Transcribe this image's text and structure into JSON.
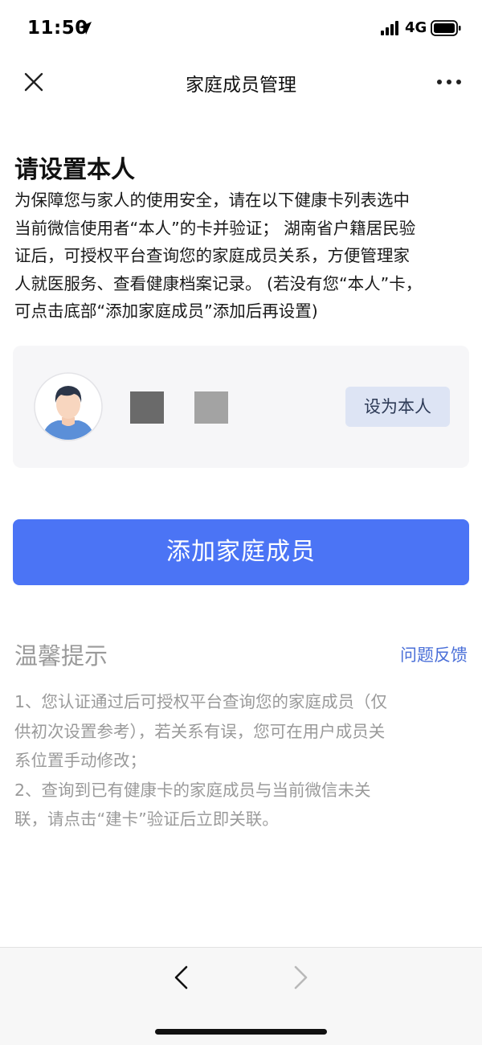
{
  "status_bar": {
    "time": "11:50",
    "network": "4G",
    "icons": [
      "location-arrow-icon",
      "signal-bars-icon",
      "battery-icon"
    ]
  },
  "nav": {
    "title": "家庭成员管理",
    "icons": [
      "close-icon",
      "more-dots-icon"
    ]
  },
  "intro": {
    "heading": "请设置本人",
    "lines": [
      "为保障您与家人的使用安全，请在以下健康卡列表选中",
      "当前微信使用者“本人”的卡并验证； 湖南省户籍居民验",
      "证后，可授权平台查询您的家庭成员关系，方便管理家",
      "人就医服务、查看健康档案记录。 (若没有您“本人”卡，",
      "可点击底部“添加家庭成员”添加后再设置)"
    ]
  },
  "member_card": {
    "avatar_icon": "user-avatar-icon",
    "set_self_label": "设为本人",
    "colors": {
      "card_bg": "#f6f6f8",
      "button_bg": "#dde4f4",
      "name_block_1": "#6a6a6a",
      "name_block_2": "#a3a3a3"
    }
  },
  "primary_action": {
    "label": "添加家庭成员",
    "color": "#4b74f5"
  },
  "tips": {
    "title": "温馨提示",
    "feedback_label": "问题反馈",
    "feedback_color": "#4a6fd8",
    "item1_lines": [
      "1、您认证通过后可授权平台查询您的家庭成员（仅",
      "供初次设置参考），若关系有误，您可在用户成员关",
      "系位置手动修改；"
    ],
    "item2_lines": [
      "2、查询到已有健康卡的家庭成员与当前微信未关",
      "联，请点击“建卡”验证后立即关联。"
    ]
  },
  "bottom_toolbar": {
    "icons": [
      "back-chevron-icon",
      "forward-chevron-icon"
    ],
    "forward_enabled": false
  }
}
